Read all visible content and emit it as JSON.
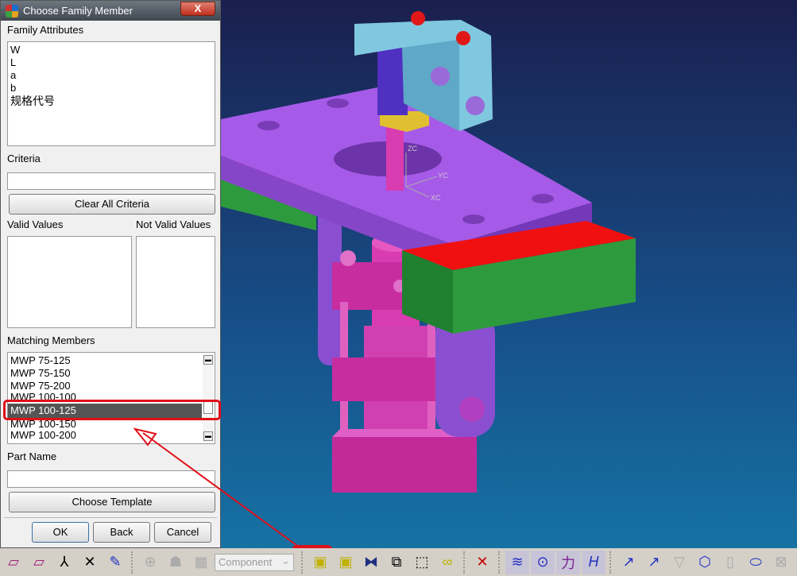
{
  "dialog": {
    "title": "Choose Family Member",
    "close_label": "X",
    "family_attributes_label": "Family Attributes",
    "family_attributes": [
      "W",
      "L",
      "a",
      "b",
      "规格代号"
    ],
    "criteria_label": "Criteria",
    "criteria_value": "",
    "clear_all_criteria_label": "Clear All Criteria",
    "valid_values_label": "Valid Values",
    "not_valid_values_label": "Not Valid Values",
    "matching_members_label": "Matching Members",
    "matching_members": [
      "MWP 75-125",
      "MWP 75-150",
      "MWP 75-200",
      "MWP 100-100",
      "MWP 100-125",
      "MWP 100-150",
      "MWP 100-200"
    ],
    "selected_member": "MWP 100-125",
    "part_name_label": "Part Name",
    "part_name_value": "",
    "choose_template_label": "Choose Template",
    "ok_label": "OK",
    "back_label": "Back",
    "cancel_label": "Cancel"
  },
  "viewport": {
    "axis_labels": {
      "zc": "ZC",
      "yc": "YC",
      "xc": "XC"
    },
    "annotation_color": "#e0101a"
  },
  "toolbar": {
    "combo_value": "Component",
    "icons": [
      "plane-down-icon",
      "plane-copy-icon",
      "csys-icon",
      "csys-origin-icon",
      "highlight-icon",
      "snap-point-icon",
      "assembly-icon",
      "cube-grid-icon",
      "add-component-icon",
      "new-component-icon",
      "mirror-icon",
      "move-icon",
      "assembly-constraint-icon",
      "link-icon",
      "delete-dim-icon",
      "spring-icon",
      "circle-point-icon",
      "force-icon",
      "h-icon",
      "vector-icon",
      "point-vector-icon",
      "surface-finish-icon",
      "nut-icon",
      "bolt-icon",
      "slot-icon",
      "weld-icon"
    ]
  }
}
